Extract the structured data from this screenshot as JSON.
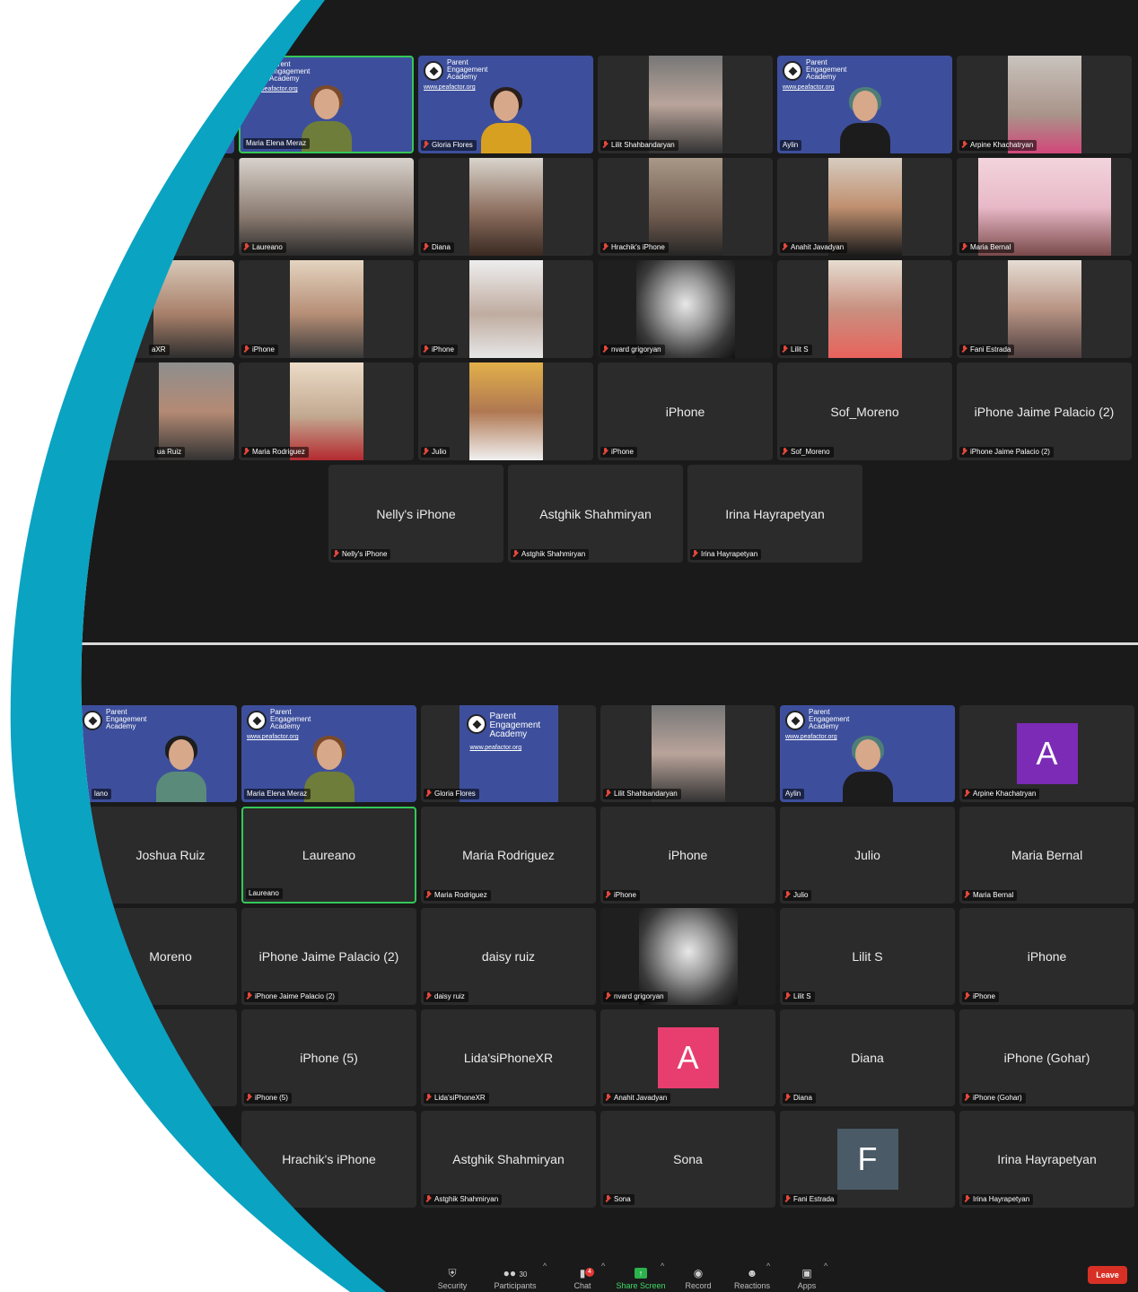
{
  "colors": {
    "meeting_bg": "#1a1a1a",
    "tile_bg": "#2b2b2b",
    "active_speaker": "#34c759",
    "brand_tile": "#3d4f9c",
    "teal_arc": "#0aa3c2",
    "leave_red": "#d93025"
  },
  "logo": {
    "line1": "Parent",
    "line2": "Engagement",
    "line3": "Academy",
    "url": "www.peafactor.org"
  },
  "shot1": {
    "tiles": [
      {
        "label": "Maria Elena Meraz"
      },
      {
        "label": "Gloria Flores"
      },
      {
        "label": "Lilit Shahbandaryan"
      },
      {
        "label": "Aylin"
      },
      {
        "label": "Arpine Khachatryan"
      },
      {
        "label": "Laureano"
      },
      {
        "label": "Diana"
      },
      {
        "label": "Hrachik's iPhone"
      },
      {
        "label": "Anahit Javadyan"
      },
      {
        "label": "Maria Bernal"
      },
      {
        "label": "aXR"
      },
      {
        "label": "iPhone"
      },
      {
        "label": "iPhone"
      },
      {
        "label": "nvard grigoryan"
      },
      {
        "label": "Lilit S"
      },
      {
        "label": "Fani Estrada"
      },
      {
        "label": "ua Ruiz"
      },
      {
        "label": "Maria Rodriguez"
      },
      {
        "label": "Julio"
      },
      {
        "name": "iPhone",
        "label": "iPhone"
      },
      {
        "name": "Sof_Moreno",
        "label": "Sof_Moreno"
      },
      {
        "name": "iPhone Jaime Palacio (2)",
        "label": "iPhone Jaime Palacio (2)"
      },
      {
        "name": "Nelly's iPhone",
        "label": "Nelly's iPhone"
      },
      {
        "name": "Astghik Shahmiryan",
        "label": "Astghik Shahmiryan"
      },
      {
        "name": "Irina Hayrapetyan",
        "label": "Irina Hayrapetyan"
      }
    ]
  },
  "shot2": {
    "tiles": [
      {
        "label": "lano"
      },
      {
        "label": "Maria Elena Meraz"
      },
      {
        "label": "Gloria Flores"
      },
      {
        "label": "Lilit Shahbandaryan"
      },
      {
        "label": "Aylin"
      },
      {
        "letter": "A",
        "label": "Arpine Khachatryan",
        "avatar_color": "#7b2bb5"
      },
      {
        "name": "Joshua Ruiz"
      },
      {
        "name": "Laureano",
        "label": "Laureano"
      },
      {
        "name": "Maria Rodriguez",
        "label": "Maria Rodriguez"
      },
      {
        "name": "iPhone",
        "label": "iPhone"
      },
      {
        "name": "Julio",
        "label": "Julio"
      },
      {
        "name": "Maria Bernal",
        "label": "Maria Bernal"
      },
      {
        "name": "Moreno"
      },
      {
        "name": "iPhone Jaime Palacio (2)",
        "label": "iPhone Jaime Palacio (2)"
      },
      {
        "name": "daisy ruiz",
        "label": "daisy ruiz"
      },
      {
        "label": "nvard grigoryan"
      },
      {
        "name": "Lilit S",
        "label": "Lilit S"
      },
      {
        "name": "iPhone",
        "label": "iPhone"
      },
      {
        "name": "iPhone (5)",
        "label": "iPhone (5)"
      },
      {
        "name": "Lida'siPhoneXR",
        "label": "Lida'siPhoneXR"
      },
      {
        "letter": "A",
        "label": "Anahit Javadyan",
        "avatar_color": "#e83e6f"
      },
      {
        "name": "Diana",
        "label": "Diana"
      },
      {
        "name": "iPhone (Gohar)",
        "label": "iPhone (Gohar)"
      },
      {
        "name": "Hrachik's iPhone",
        "label": "iPhone"
      },
      {
        "name": "Astghik Shahmiryan",
        "label": "Astghik Shahmiryan"
      },
      {
        "name": "Sona",
        "label": "Sona"
      },
      {
        "letter": "F",
        "label": "Fani Estrada",
        "avatar_color": "#4a5a66"
      },
      {
        "name": "Irina Hayrapetyan",
        "label": "Irina Hayrapetyan"
      }
    ]
  },
  "toolbar": {
    "security": "Security",
    "participants": "Participants",
    "participants_count": "30",
    "chat": "Chat",
    "chat_badge": "4",
    "share": "Share Screen",
    "record": "Record",
    "reactions": "Reactions",
    "apps": "Apps",
    "leave": "Leave"
  }
}
